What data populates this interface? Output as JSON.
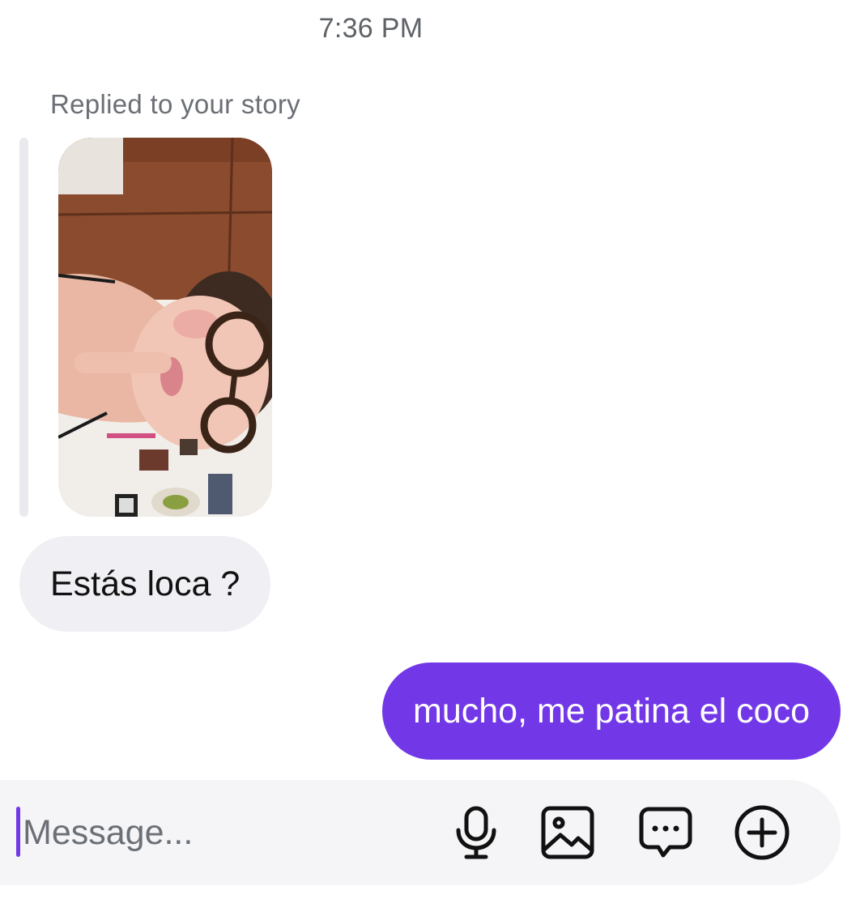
{
  "conversation": {
    "timestamp": "7:36 PM",
    "story_reply": {
      "label": "Replied to your story"
    },
    "messages": [
      {
        "direction": "incoming",
        "text": "Estás loca ?"
      },
      {
        "direction": "outgoing",
        "text": "mucho, me patina el coco"
      }
    ]
  },
  "composer": {
    "placeholder": "Message...",
    "value": ""
  },
  "icons": {
    "voice": "microphone-icon",
    "gallery": "image-icon",
    "sticker": "chat-bubble-dots-icon",
    "more": "plus-circle-icon"
  },
  "colors": {
    "accent": "#7238e8",
    "incoming_bubble": "#efeff4",
    "muted_text": "#6b6f76"
  }
}
